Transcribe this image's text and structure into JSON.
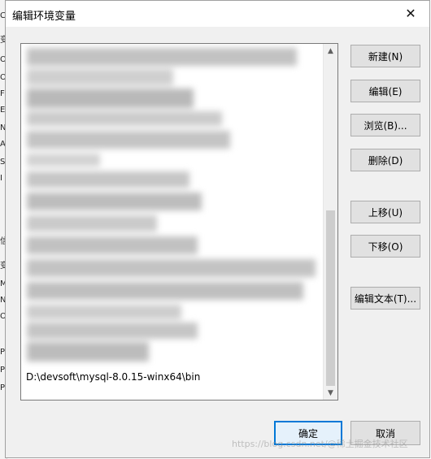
{
  "dialog": {
    "title": "编辑环境变量",
    "close_glyph": "✕"
  },
  "background_fragments": [
    "C",
    "变",
    "O",
    "O",
    "F",
    "E",
    "N",
    "A",
    "S",
    "I",
    "信",
    "变",
    "M",
    "N",
    "O",
    "P",
    "P",
    "P"
  ],
  "path_list": {
    "visible_entry": "D:\\devsoft\\mysql-8.0.15-winx64\\bin",
    "scroll_up_glyph": "▲",
    "scroll_down_glyph": "▼"
  },
  "buttons": {
    "new": "新建(N)",
    "edit": "编辑(E)",
    "browse": "浏览(B)...",
    "delete": "删除(D)",
    "move_up": "上移(U)",
    "move_down": "下移(O)",
    "edit_text": "编辑文本(T)...",
    "ok": "确定",
    "cancel": "取消"
  },
  "watermark": "https://blog.csdn.net/@稀土掘金技术社区",
  "colors": {
    "accent": "#0078d7",
    "button_face": "#e1e1e1",
    "dialog_bg": "#f0f0f0"
  }
}
